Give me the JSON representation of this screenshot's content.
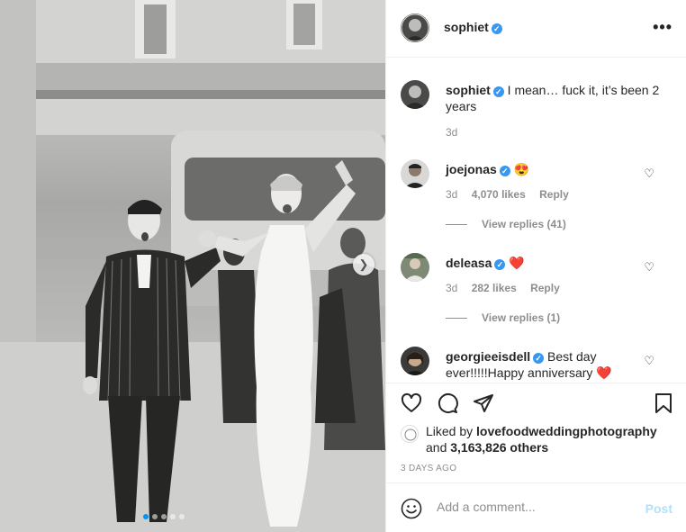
{
  "post": {
    "author": "sophiet",
    "caption": "I mean… fuck it, it’s been 2 years",
    "caption_age": "3d"
  },
  "comments": [
    {
      "user": "joejonas",
      "text": "😍",
      "age": "3d",
      "likes": "4,070 likes",
      "reply": "Reply",
      "view_replies": "View replies (41)"
    },
    {
      "user": "deleasa",
      "text": "❤️",
      "age": "3d",
      "likes": "282 likes",
      "reply": "Reply",
      "view_replies": "View replies (1)"
    },
    {
      "user": "georgieeisdell",
      "text": "Best day ever!!!!!Happy anniversary ❤️"
    }
  ],
  "likes": {
    "prefix": "Liked by",
    "liker": "lovefoodweddingphotography",
    "and": "and",
    "others": "3,163,826 others"
  },
  "timestamp": "3 DAYS AGO",
  "add_comment": {
    "placeholder": "Add a comment...",
    "post_label": "Post"
  },
  "icons": {
    "more": "more-horizontal-icon",
    "verified": "verified-badge-icon",
    "heart": "heart-icon",
    "comment": "comment-icon",
    "share": "share-icon",
    "save": "bookmark-icon",
    "emoji": "emoji-icon",
    "next": "chevron-right-icon"
  },
  "colors": {
    "verified": "#3897f0",
    "post_disabled": "#b2dffc",
    "muted": "#8e8e8e",
    "heart_red": "#ed4956"
  },
  "carousel": {
    "slides": 5,
    "active": 1
  }
}
